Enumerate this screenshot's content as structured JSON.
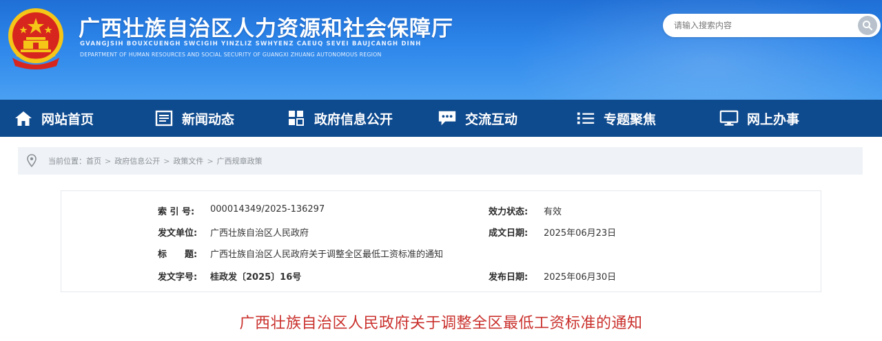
{
  "header": {
    "title": "广西壮族自治区人力资源和社会保障厅",
    "pinyin": "GVANGJSIH BOUXCUENGH SWCIGIH YINZLIZ SWHYENZ CAEUQ SEVEI BAUJCANGH DINH",
    "english": "DEPARTMENT OF HUMAN RESOURCES AND SOCIAL SECURITY OF GUANGXI ZHUANG AUTONOMOUS REGION",
    "search_placeholder": "请输入搜索内容"
  },
  "nav": {
    "items": [
      {
        "label": "网站首页",
        "icon": "home-icon"
      },
      {
        "label": "新闻动态",
        "icon": "news-icon"
      },
      {
        "label": "政府信息公开",
        "icon": "grid-icon"
      },
      {
        "label": "交流互动",
        "icon": "chat-icon"
      },
      {
        "label": "专题聚焦",
        "icon": "list-icon"
      },
      {
        "label": "网上办事",
        "icon": "monitor-icon"
      }
    ]
  },
  "breadcrumb": {
    "prefix": "当前位置：",
    "items": [
      "首页",
      "政府信息公开",
      "政策文件",
      "广西规章政策"
    ],
    "separator": ">"
  },
  "info": {
    "index_label": "索 引 号:",
    "index_value": "000014349/2025-136297",
    "status_label": "效力状态:",
    "status_value": "有效",
    "issuer_label": "发文单位:",
    "issuer_value": "广西壮族自治区人民政府",
    "written_label": "成文日期:",
    "written_value": "2025年06月23日",
    "title_label": "标　　题:",
    "title_value": "广西壮族自治区人民政府关于调整全区最低工资标准的通知",
    "docno_label": "发文字号:",
    "docno_value": "桂政发〔2025〕16号",
    "published_label": "发布日期:",
    "published_value": "2025年06月30日"
  },
  "document": {
    "title": "广西壮族自治区人民政府关于调整全区最低工资标准的通知"
  },
  "colors": {
    "header_blue": "#2d86ea",
    "nav_blue": "#0e4a8e",
    "title_red": "#c9302c",
    "emblem_red": "#d7261e",
    "emblem_gold": "#f5c518"
  }
}
